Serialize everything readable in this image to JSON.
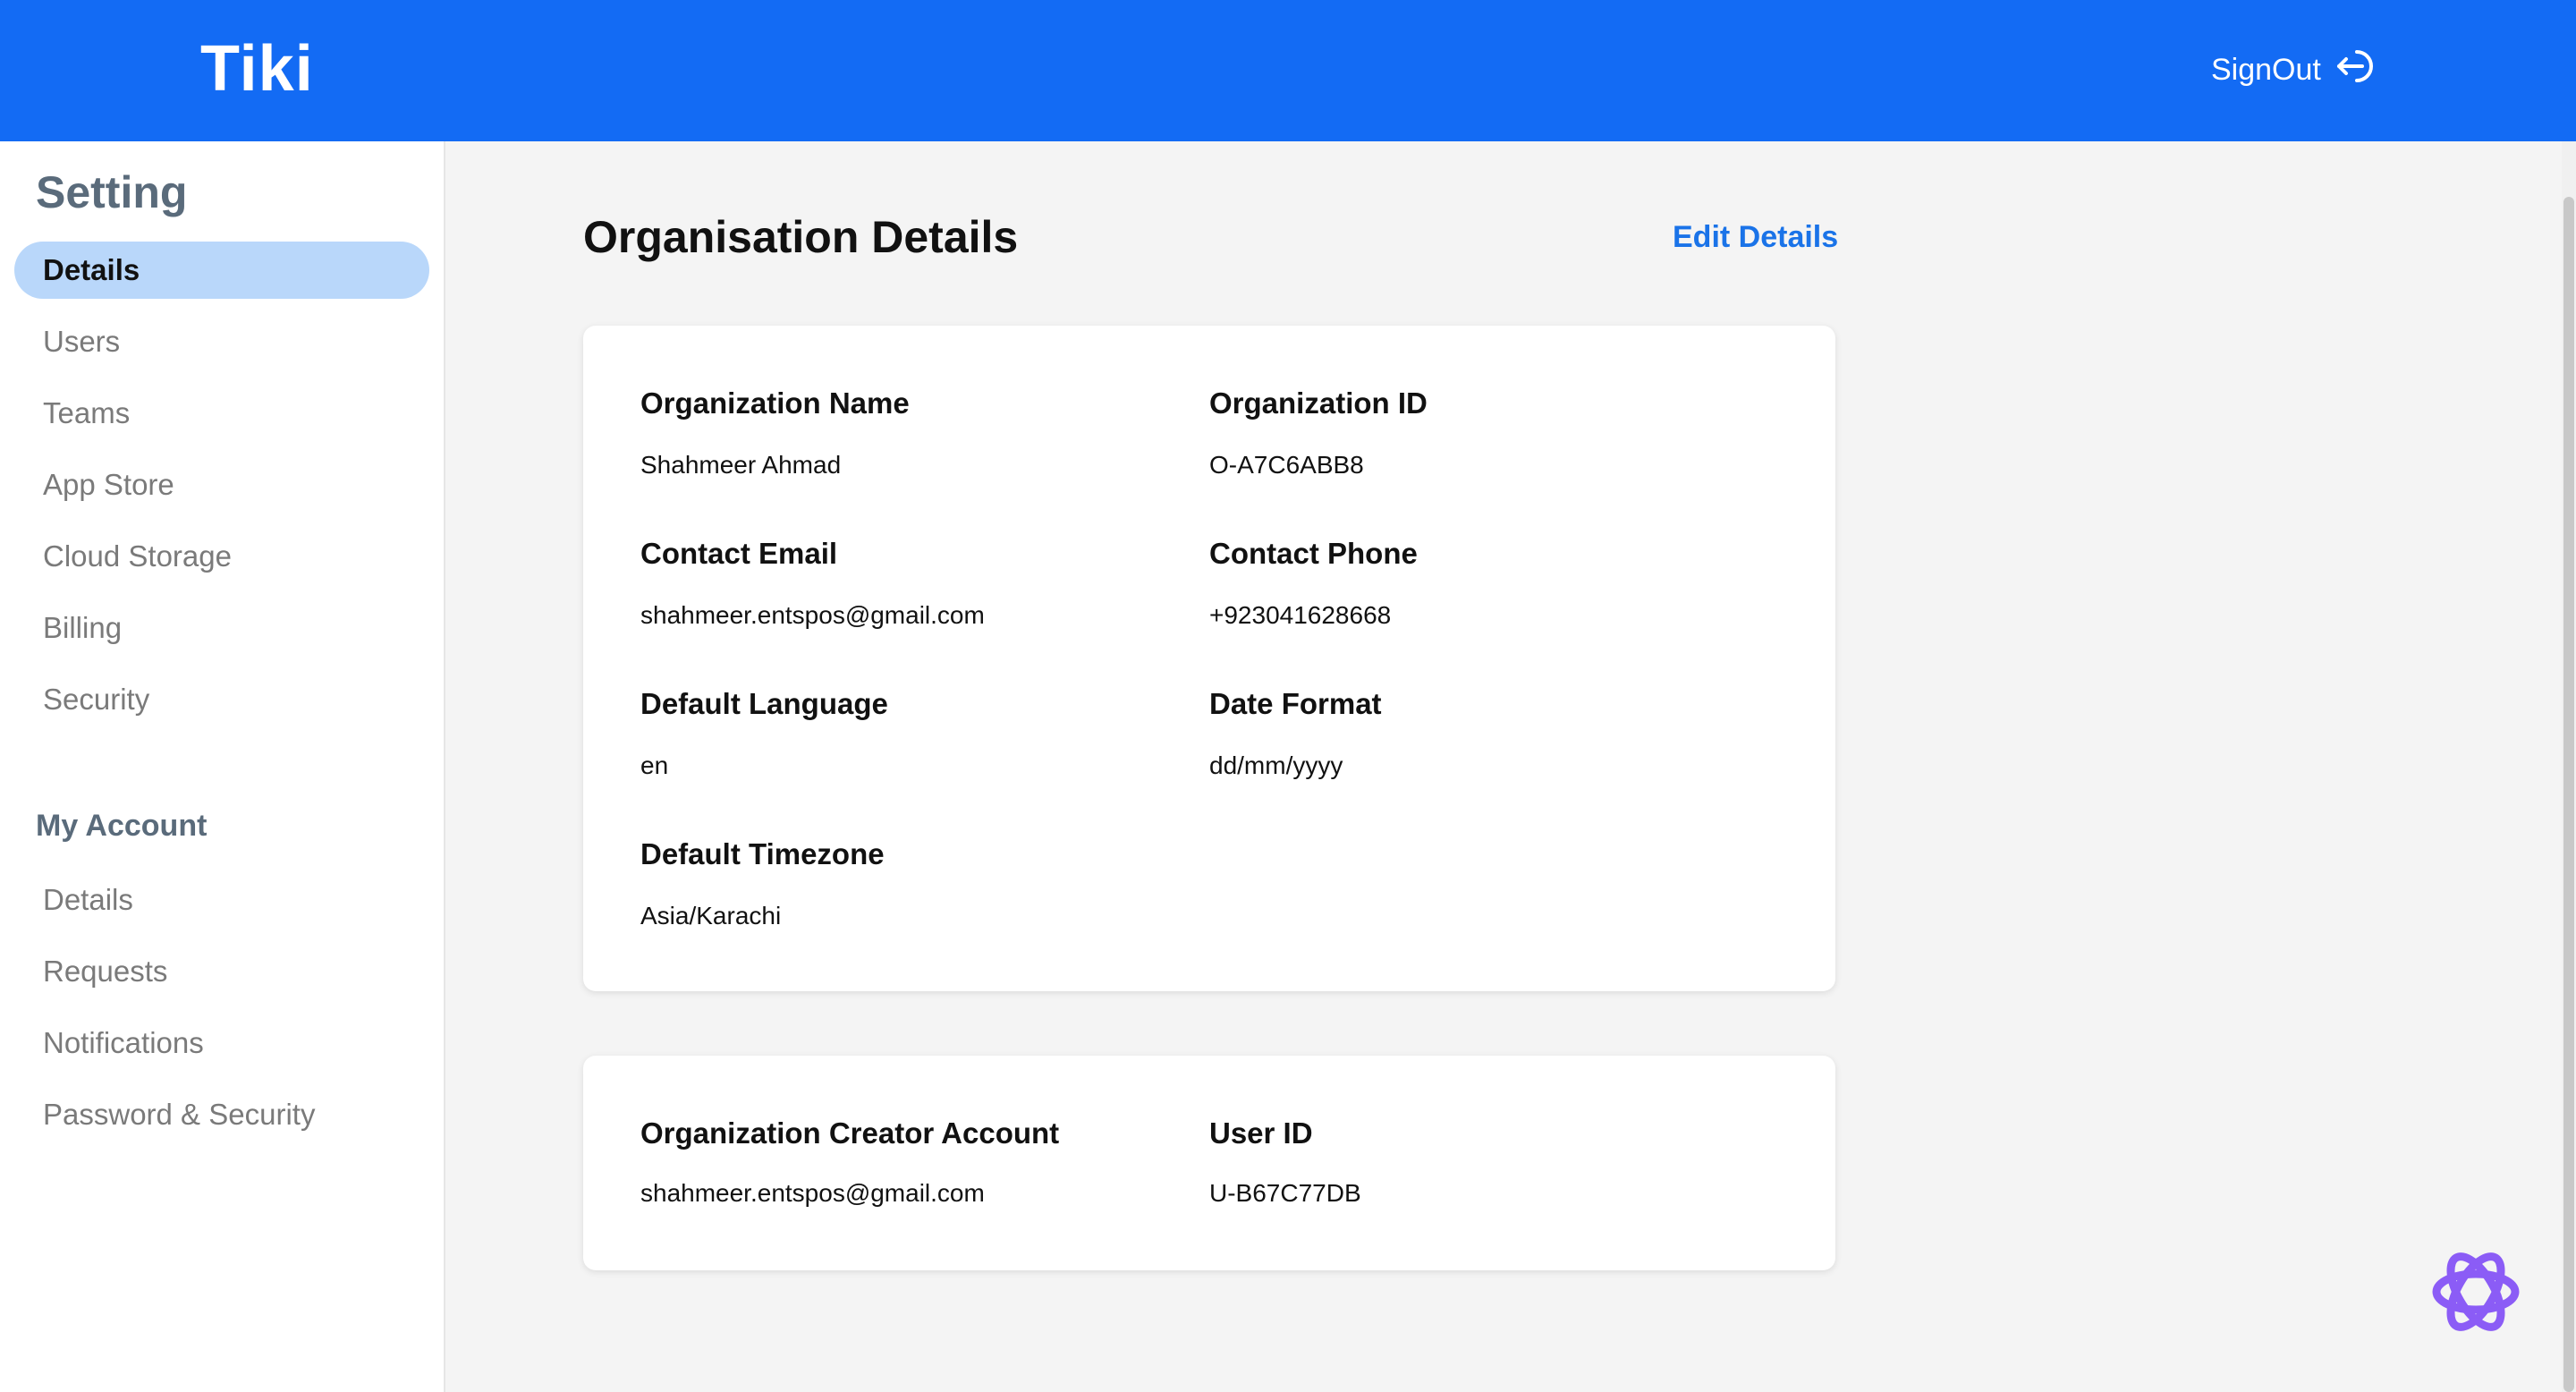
{
  "header": {
    "logo": "Tiki",
    "signout_label": "SignOut",
    "signout_icon": "signout-icon",
    "background": "#136bf4"
  },
  "sidebar": {
    "title": "Setting",
    "settings_items": [
      {
        "label": "Details",
        "active": true
      },
      {
        "label": "Users"
      },
      {
        "label": "Teams"
      },
      {
        "label": "App Store"
      },
      {
        "label": "Cloud Storage"
      },
      {
        "label": "Billing"
      },
      {
        "label": "Security"
      }
    ],
    "account_section": "My Account",
    "account_items": [
      {
        "label": "Details"
      },
      {
        "label": "Requests"
      },
      {
        "label": "Notifications"
      },
      {
        "label": "Password & Security"
      }
    ],
    "active_bg": "#b9d7fa"
  },
  "main": {
    "title": "Organisation Details",
    "edit_label": "Edit Details",
    "accent": "#1a73e8",
    "org_card": {
      "fields": [
        {
          "label": "Organization Name",
          "value": "Shahmeer Ahmad"
        },
        {
          "label": "Organization ID",
          "value": "O-A7C6ABB8"
        },
        {
          "label": "Contact Email",
          "value": "shahmeer.entspos@gmail.com"
        },
        {
          "label": "Contact Phone",
          "value": "+923041628668"
        },
        {
          "label": "Default Language",
          "value": "en"
        },
        {
          "label": "Date Format",
          "value": "dd/mm/yyyy"
        },
        {
          "label": "Default Timezone",
          "value": "Asia/Karachi"
        }
      ]
    },
    "creator_card": {
      "fields": [
        {
          "label": "Organization Creator Account",
          "value": "shahmeer.entspos@gmail.com"
        },
        {
          "label": "User ID",
          "value": "U-B67C77DB"
        }
      ]
    }
  },
  "chat_fab_icon": "openai-chat-icon"
}
